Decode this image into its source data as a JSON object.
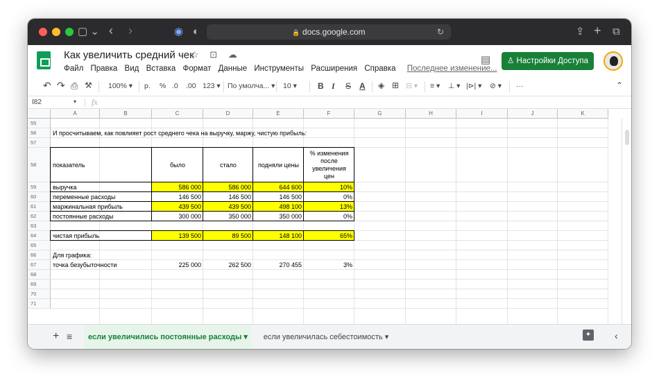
{
  "browser": {
    "url": "docs.google.com",
    "lock_icon": "🔒",
    "reload_icon": "↻",
    "sidebar_icon": "▢ ⌄",
    "back_icon": "‹",
    "forward_icon": "›",
    "shield_icon": "◉",
    "privacy_icon": "◐",
    "share_icon": "⇪",
    "newtab_icon": "+",
    "tabs_icon": "⧉"
  },
  "doc": {
    "title": "Как увеличить средний чек",
    "title_icons": "☆ ⊡ ☁",
    "menus": [
      "Файл",
      "Правка",
      "Вид",
      "Вставка",
      "Формат",
      "Данные",
      "Инструменты",
      "Расширения",
      "Справка"
    ],
    "last_edit": "Последнее изменение...",
    "share_label": "Настройки Доступа",
    "share_icon": "♙",
    "comment_icon": "▤"
  },
  "toolbar": {
    "undo": "↶",
    "redo": "↷",
    "print": "⎙",
    "paint": "⚒",
    "zoom": "100% ▾",
    "currency": "р.",
    "percent": "%",
    "dec_less": ".0",
    "dec_more": ".00",
    "format": "123 ▾",
    "font": "По умолча... ▾",
    "size": "10 ▾",
    "bold": "B",
    "italic": "I",
    "strike": "S",
    "underline_a": "A",
    "fill": "◈",
    "borders": "⊞",
    "merge": "⊟ ▾",
    "halign": "≡ ▾",
    "valign": "⊥ ▾",
    "wrap": "|⊳| ▾",
    "rotate": "⊘ ▾",
    "more": "···",
    "collapse": "⌃"
  },
  "formula_bar": {
    "cell_ref": "I82",
    "ref_caret": "▾",
    "fx": "fx",
    "value": ""
  },
  "columns": [
    "A",
    "B",
    "C",
    "D",
    "E",
    "F",
    "G",
    "H",
    "I",
    "J",
    "K"
  ],
  "rows": [
    "55",
    "56",
    "57",
    "58",
    "59",
    "60",
    "61",
    "62",
    "63",
    "64",
    "65",
    "66",
    "67",
    "68",
    "69",
    "70",
    "71"
  ],
  "row56_text": "И просчитываем, как повлияет рост среднего чека на выручку, маржу, чистую прибыль:",
  "table": {
    "header": {
      "label": "показатель",
      "c": "было",
      "d": "стало",
      "e": "подняли цены",
      "f": [
        "% изменения",
        "после",
        "увеличения",
        "цен"
      ]
    },
    "rows": [
      {
        "label": "выручка",
        "c": "586 000",
        "d": "586 000",
        "e": "644 600",
        "f": "10%",
        "hl": true
      },
      {
        "label": "переменные расходы",
        "c": "146 500",
        "d": "146 500",
        "e": "146 500",
        "f": "0%",
        "hl": false
      },
      {
        "label": "маржинальная прибыль",
        "c": "439 500",
        "d": "439 500",
        "e": "498 100",
        "f": "13%",
        "hl": true
      },
      {
        "label": "постоянные расходы",
        "c": "300 000",
        "d": "350 000",
        "e": "350 000",
        "f": "0%",
        "hl": false
      }
    ],
    "net": {
      "label": "чистая прибыль",
      "c": "139 500",
      "d": "89 500",
      "e": "148 100",
      "f": "65%"
    }
  },
  "chart_label": "Для графика:",
  "breakeven": {
    "label": "точка безубыточности",
    "c": "225 000",
    "d": "262 500",
    "e": "270 455",
    "f": "3%"
  },
  "sheets": {
    "add": "+",
    "list": "≡",
    "active": "если увеличились постоянные расходы ▾",
    "other": "если увеличилась себестоимость ▾",
    "explore_icon": "✦",
    "collapse_icon": "‹"
  }
}
